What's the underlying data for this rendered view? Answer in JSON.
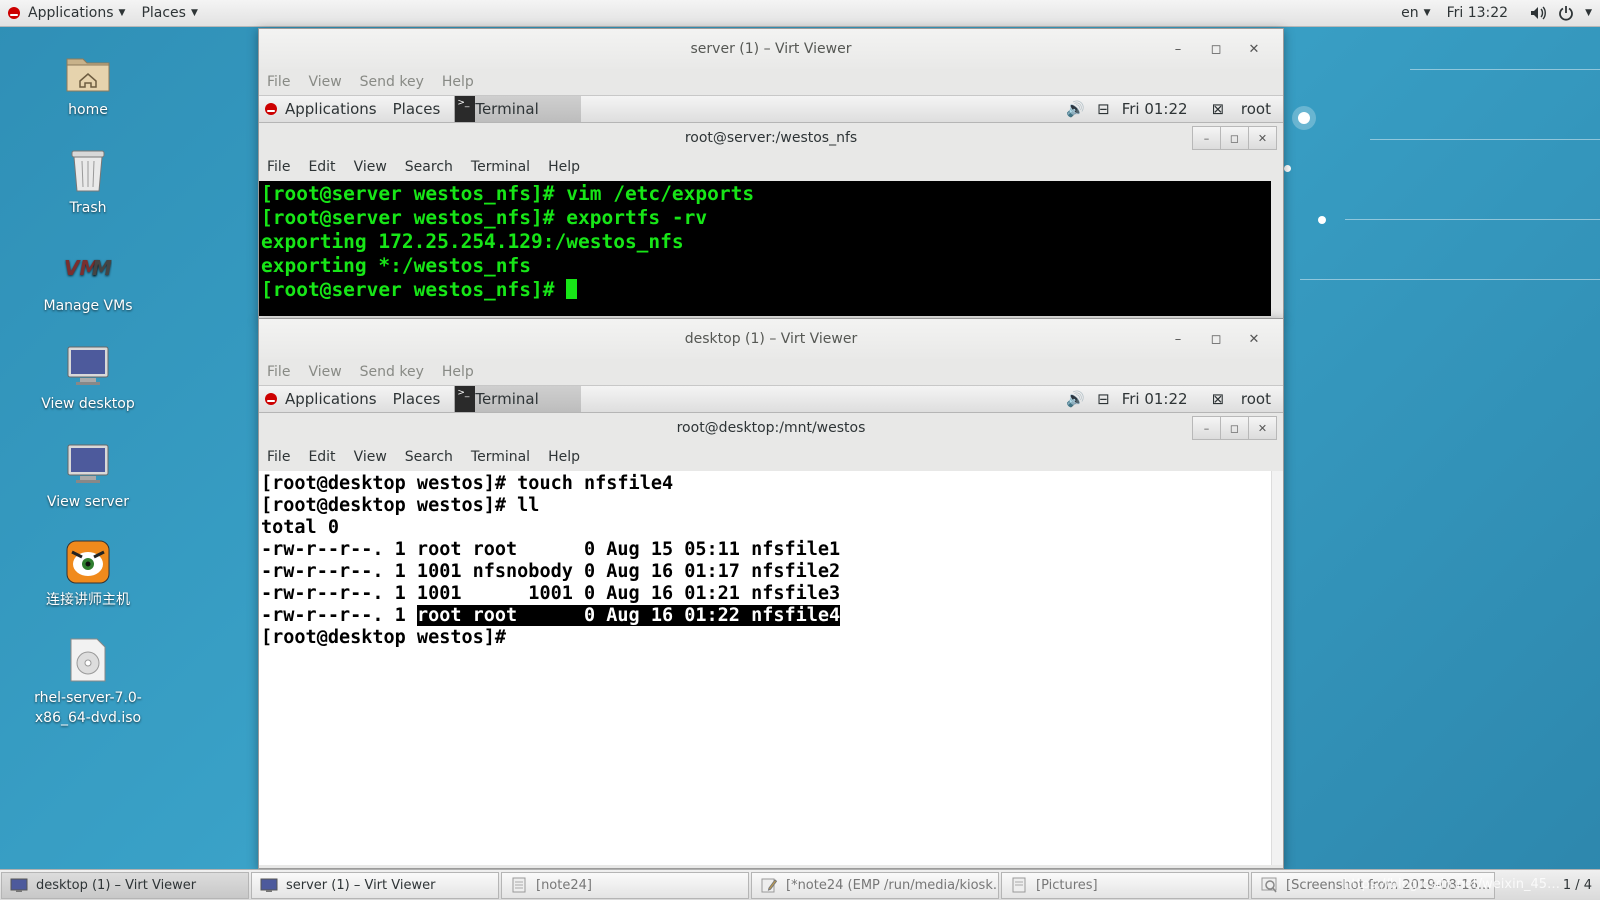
{
  "top_panel": {
    "applications": "Applications",
    "places": "Places",
    "lang": "en",
    "clock": "Fri 13:22",
    "volume_icon": "volume-icon",
    "power_icon": "power-icon"
  },
  "desktop_icons": [
    {
      "label": "home",
      "icon": "home-folder-icon"
    },
    {
      "label": "Trash",
      "icon": "trash-icon"
    },
    {
      "label": "Manage VMs",
      "icon": "vmm-icon"
    },
    {
      "label": "View desktop",
      "icon": "monitor-icon"
    },
    {
      "label": "View server",
      "icon": "monitor-icon"
    },
    {
      "label": "连接讲师主机",
      "icon": "tiger-icon"
    },
    {
      "label": "rhel-server-7.0-x86_64-dvd.iso",
      "icon": "disc-icon"
    }
  ],
  "server_window": {
    "title": "server (1) – Virt Viewer",
    "menu": [
      "File",
      "View",
      "Send key",
      "Help"
    ],
    "guest_panel": {
      "applications": "Applications",
      "places": "Places",
      "terminal": "Terminal",
      "clock": "Fri 01:22",
      "user": "root"
    },
    "terminal": {
      "title": "root@server:/westos_nfs",
      "menu": [
        "File",
        "Edit",
        "View",
        "Search",
        "Terminal",
        "Help"
      ],
      "lines": [
        "[root@server westos_nfs]# vim /etc/exports",
        "[root@server westos_nfs]# exportfs -rv",
        "exporting 172.25.254.129:/westos_nfs",
        "exporting *:/westos_nfs",
        "[root@server westos_nfs]# "
      ]
    }
  },
  "desktop_window": {
    "title": "desktop (1) – Virt Viewer",
    "menu": [
      "File",
      "View",
      "Send key",
      "Help"
    ],
    "guest_panel": {
      "applications": "Applications",
      "places": "Places",
      "terminal": "Terminal",
      "clock": "Fri 01:22",
      "user": "root"
    },
    "terminal": {
      "title": "root@desktop:/mnt/westos",
      "menu": [
        "File",
        "Edit",
        "View",
        "Search",
        "Terminal",
        "Help"
      ],
      "lines": [
        "[root@desktop westos]# touch nfsfile4",
        "[root@desktop westos]# ll",
        "total 0",
        "-rw-r--r--. 1 root root      0 Aug 15 05:11 nfsfile1",
        "-rw-r--r--. 1 1001 nfsnobody 0 Aug 16 01:17 nfsfile2",
        "-rw-r--r--. 1 1001      1001 0 Aug 16 01:21 nfsfile3"
      ],
      "selected_line_prefix": "-rw-r--r--. 1 ",
      "selected_line_highlight": "root root      0 Aug 16 01:22 nfsfile4",
      "prompt": "[root@desktop westos]# "
    }
  },
  "taskbar": {
    "tasks": [
      {
        "label": "desktop (1) – Virt Viewer",
        "icon": "monitor-icon"
      },
      {
        "label": "server (1) – Virt Viewer",
        "icon": "monitor-icon"
      },
      {
        "label": "[note24]",
        "icon": "document-icon"
      },
      {
        "label": "[*note24 (EMP /run/media/kiosk...",
        "icon": "editor-icon"
      },
      {
        "label": "[Pictures]",
        "icon": "folder-icon"
      },
      {
        "label": "[Screenshot from 2019-08-16...",
        "icon": "image-viewer-icon"
      }
    ],
    "pager": "1 / 4",
    "watermark": "https://blog.csdn.net/weixin_45…"
  }
}
